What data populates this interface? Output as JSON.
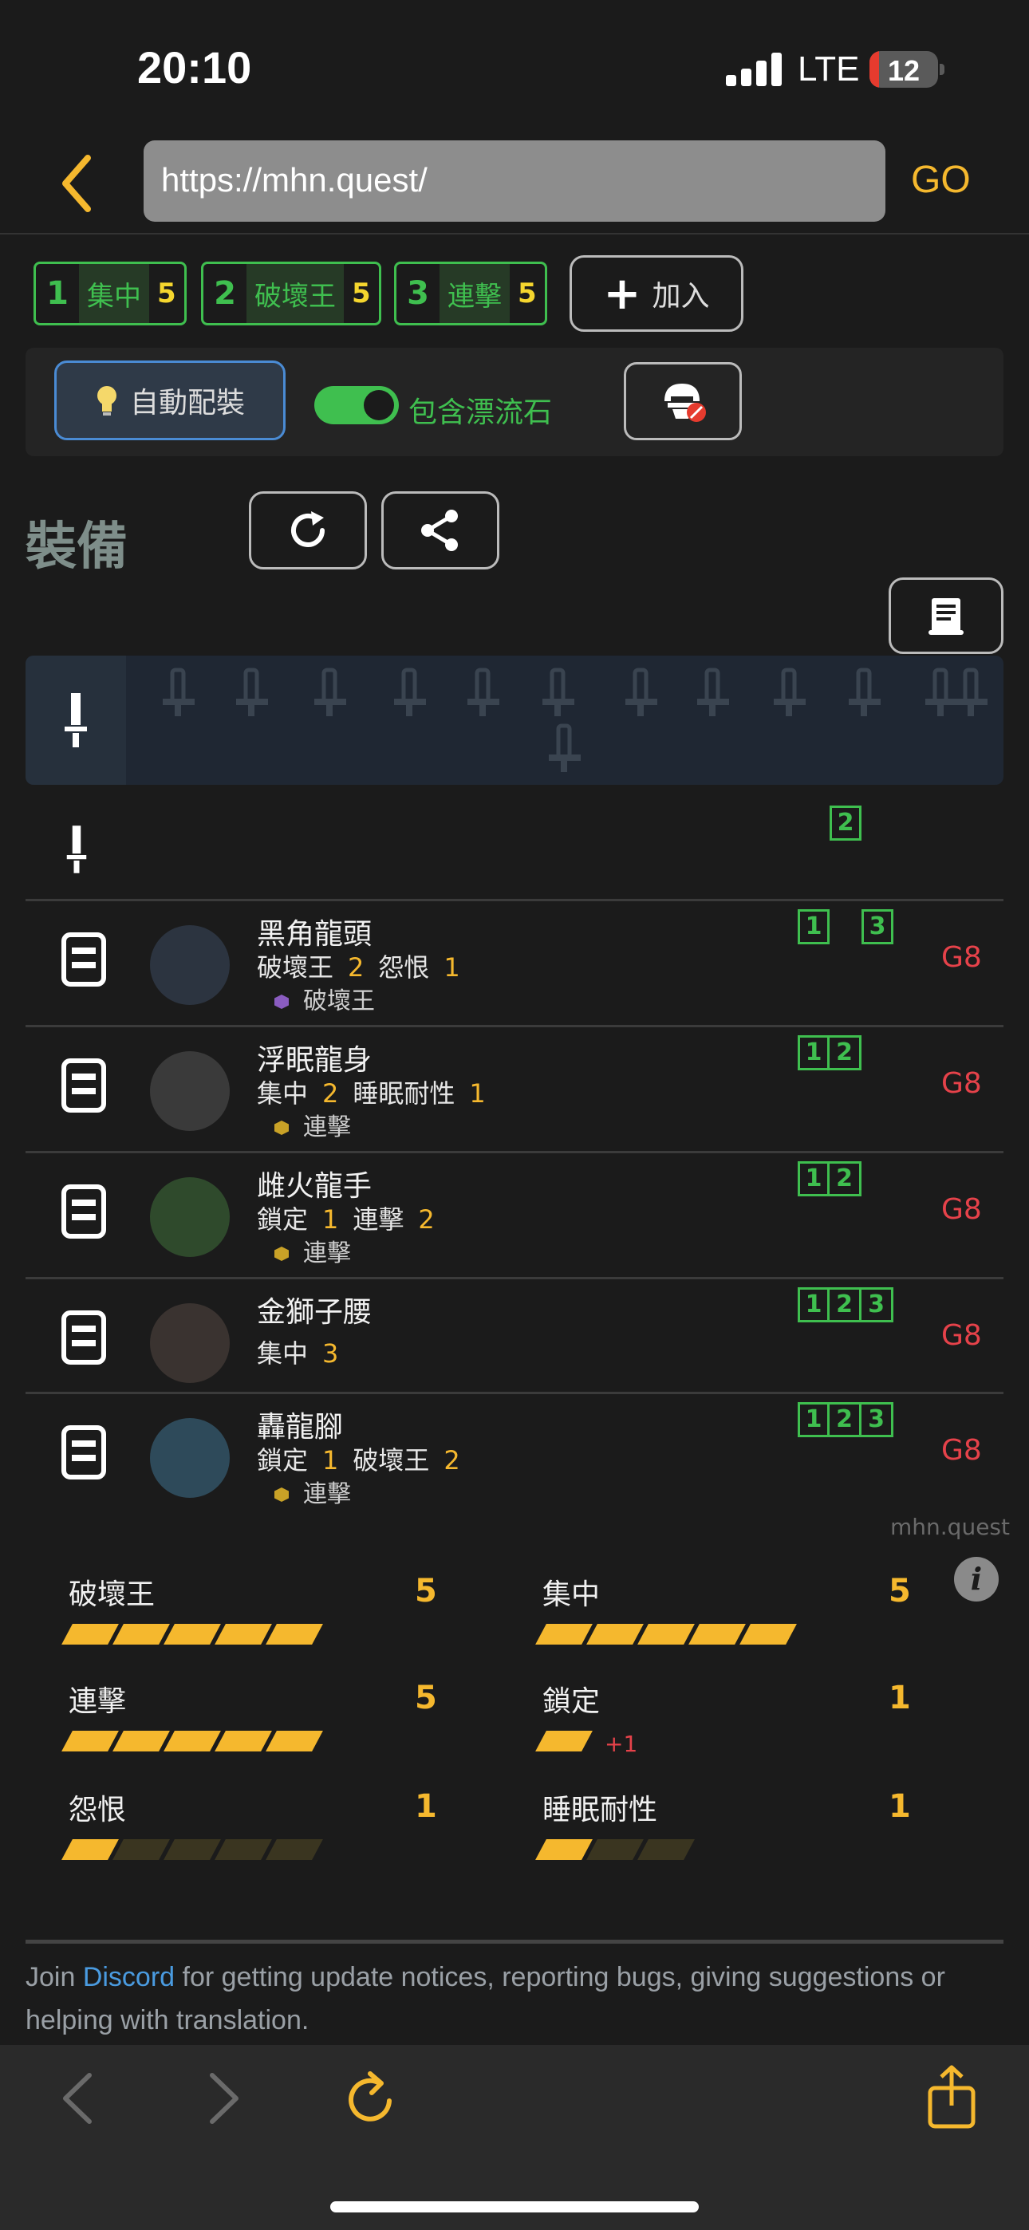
{
  "status_bar": {
    "time": "20:10",
    "network": "LTE",
    "battery": "12"
  },
  "browser": {
    "url": "https://mhn.quest/",
    "go_label": "GO"
  },
  "skill_chips": [
    {
      "num": "1",
      "name": "集中",
      "level": "5"
    },
    {
      "num": "2",
      "name": "破壞王",
      "level": "5"
    },
    {
      "num": "3",
      "name": "連擊",
      "level": "5"
    }
  ],
  "add_label": "加入",
  "auto_label": "自動配裝",
  "toggle_label": "包含漂流石",
  "equipment_title": "裝備",
  "weapon_slot": "2",
  "equipment": [
    {
      "name": "黑角龍頭",
      "skills": [
        [
          "破壞王",
          "2"
        ],
        [
          "怨恨",
          "1"
        ]
      ],
      "deco": "破壞王",
      "deco_color": "#8a5cc0",
      "slots": [
        "1",
        "3"
      ],
      "grade": "G8"
    },
    {
      "name": "浮眠龍身",
      "skills": [
        [
          "集中",
          "2"
        ],
        [
          "睡眠耐性",
          "1"
        ]
      ],
      "deco": "連擊",
      "deco_color": "#c9a227",
      "slots": [
        "1",
        "2"
      ],
      "grade": "G8"
    },
    {
      "name": "雌火龍手",
      "skills": [
        [
          "鎖定",
          "1"
        ],
        [
          "連擊",
          "2"
        ]
      ],
      "deco": "連擊",
      "deco_color": "#c9a227",
      "slots": [
        "1",
        "2"
      ],
      "grade": "G8"
    },
    {
      "name": "金獅子腰",
      "skills": [
        [
          "集中",
          "3"
        ]
      ],
      "deco": "",
      "deco_color": "",
      "slots": [
        "1",
        "2",
        "3"
      ],
      "grade": "G8"
    },
    {
      "name": "轟龍腳",
      "skills": [
        [
          "鎖定",
          "1"
        ],
        [
          "破壞王",
          "2"
        ]
      ],
      "deco": "連擊",
      "deco_color": "#c9a227",
      "slots": [
        "1",
        "2",
        "3"
      ],
      "grade": "G8"
    }
  ],
  "watermark": "mhn.quest",
  "skill_summary": [
    {
      "name": "破壞王",
      "level": "5",
      "max": 5
    },
    {
      "name": "集中",
      "level": "5",
      "max": 5
    },
    {
      "name": "連擊",
      "level": "5",
      "max": 5
    },
    {
      "name": "鎖定",
      "level": "1",
      "max": 1,
      "bonus": "+1"
    },
    {
      "name": "怨恨",
      "level": "1",
      "max": 5
    },
    {
      "name": "睡眠耐性",
      "level": "1",
      "max": 3
    }
  ],
  "footer": {
    "prefix": "Join ",
    "link": "Discord",
    "suffix": " for getting update notices, reporting bugs, giving suggestions or helping with translation."
  },
  "colors": {
    "accent": "#f5b82e",
    "green": "#3fbf4f",
    "grade_red": "#e6424a"
  }
}
